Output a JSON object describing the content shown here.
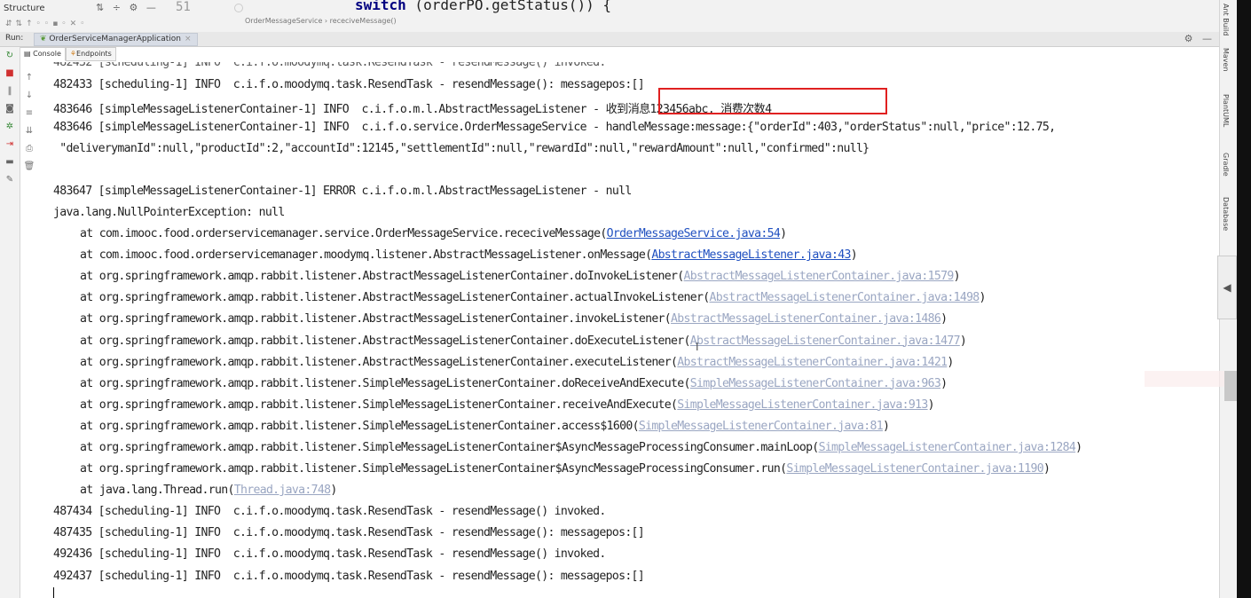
{
  "structure_panel": {
    "title": "Structure"
  },
  "editor": {
    "line_number": "51",
    "code_keyword": "switch",
    "code_rest": " (orderPO.getStatus()) {",
    "breadcrumb": [
      "OrderMessageService",
      "receciveMessage()"
    ]
  },
  "run": {
    "label": "Run:",
    "config": "OrderServiceManagerApplication",
    "subtabs": [
      "Console",
      "Endpoints"
    ]
  },
  "right_tool_windows": [
    "Ant Build",
    "Maven",
    "PlantUML",
    "Gradle",
    "Database"
  ],
  "console": {
    "partial_top_line": "482432 [scheduling-1] INFO  c.i.f.o.moodymq.task.ResendTask - resendMessage() invoked.",
    "lines": [
      {
        "text": "482433 [scheduling-1] INFO  c.i.f.o.moodymq.task.ResendTask - resendMessage(): messagepos:[]"
      },
      {
        "text": "483646 [simpleMessageListenerContainer-1] INFO  c.i.f.o.m.l.AbstractMessageListener - 收到消息123456abc, 消费次数4"
      },
      {
        "text": "483646 [simpleMessageListenerContainer-1] INFO  c.i.f.o.service.OrderMessageService - handleMessage:message:{\"orderId\":403,\"orderStatus\":null,\"price\":12.75,"
      },
      {
        "text": " \"deliverymanId\":null,\"productId\":2,\"accountId\":12145,\"settlementId\":null,\"rewardId\":null,\"rewardAmount\":null,\"confirmed\":null}"
      },
      {
        "text": ""
      },
      {
        "text": "483647 [simpleMessageListenerContainer-1] ERROR c.i.f.o.m.l.AbstractMessageListener - null"
      },
      {
        "text": "java.lang.NullPointerException: null"
      }
    ],
    "stack": [
      {
        "at": "at com.imooc.food.orderservicemanager.service.OrderMessageService.receciveMessage(",
        "link": "OrderMessageService.java:54",
        "dim": false
      },
      {
        "at": "at com.imooc.food.orderservicemanager.moodymq.listener.AbstractMessageListener.onMessage(",
        "link": "AbstractMessageListener.java:43",
        "dim": false
      },
      {
        "at": "at org.springframework.amqp.rabbit.listener.AbstractMessageListenerContainer.doInvokeListener(",
        "link": "AbstractMessageListenerContainer.java:1579",
        "dim": true
      },
      {
        "at": "at org.springframework.amqp.rabbit.listener.AbstractMessageListenerContainer.actualInvokeListener(",
        "link": "AbstractMessageListenerContainer.java:1498",
        "dim": true
      },
      {
        "at": "at org.springframework.amqp.rabbit.listener.AbstractMessageListenerContainer.invokeListener(",
        "link": "AbstractMessageListenerContainer.java:1486",
        "dim": true
      },
      {
        "at": "at org.springframework.amqp.rabbit.listener.AbstractMessageListenerContainer.doExecuteListener(",
        "link": "AbstractMessageListenerContainer.java:1477",
        "dim": true
      },
      {
        "at": "at org.springframework.amqp.rabbit.listener.AbstractMessageListenerContainer.executeListener(",
        "link": "AbstractMessageListenerContainer.java:1421",
        "dim": true
      },
      {
        "at": "at org.springframework.amqp.rabbit.listener.SimpleMessageListenerContainer.doReceiveAndExecute(",
        "link": "SimpleMessageListenerContainer.java:963",
        "dim": true
      },
      {
        "at": "at org.springframework.amqp.rabbit.listener.SimpleMessageListenerContainer.receiveAndExecute(",
        "link": "SimpleMessageListenerContainer.java:913",
        "dim": true
      },
      {
        "at": "at org.springframework.amqp.rabbit.listener.SimpleMessageListenerContainer.access$1600(",
        "link": "SimpleMessageListenerContainer.java:81",
        "dim": true
      },
      {
        "at": "at org.springframework.amqp.rabbit.listener.SimpleMessageListenerContainer$AsyncMessageProcessingConsumer.mainLoop(",
        "link": "SimpleMessageListenerContainer.java:1284",
        "dim": true
      },
      {
        "at": "at org.springframework.amqp.rabbit.listener.SimpleMessageListenerContainer$AsyncMessageProcessingConsumer.run(",
        "link": "SimpleMessageListenerContainer.java:1190",
        "dim": true
      },
      {
        "at": "at java.lang.Thread.run(",
        "link": "Thread.java:748",
        "dim": true
      }
    ],
    "tail": [
      {
        "text": "487434 [scheduling-1] INFO  c.i.f.o.moodymq.task.ResendTask - resendMessage() invoked."
      },
      {
        "text": "487435 [scheduling-1] INFO  c.i.f.o.moodymq.task.ResendTask - resendMessage(): messagepos:[]"
      },
      {
        "text": "492436 [scheduling-1] INFO  c.i.f.o.moodymq.task.ResendTask - resendMessage() invoked."
      },
      {
        "text": "492437 [scheduling-1] INFO  c.i.f.o.moodymq.task.ResendTask - resendMessage(): messagepos:[]"
      }
    ]
  }
}
